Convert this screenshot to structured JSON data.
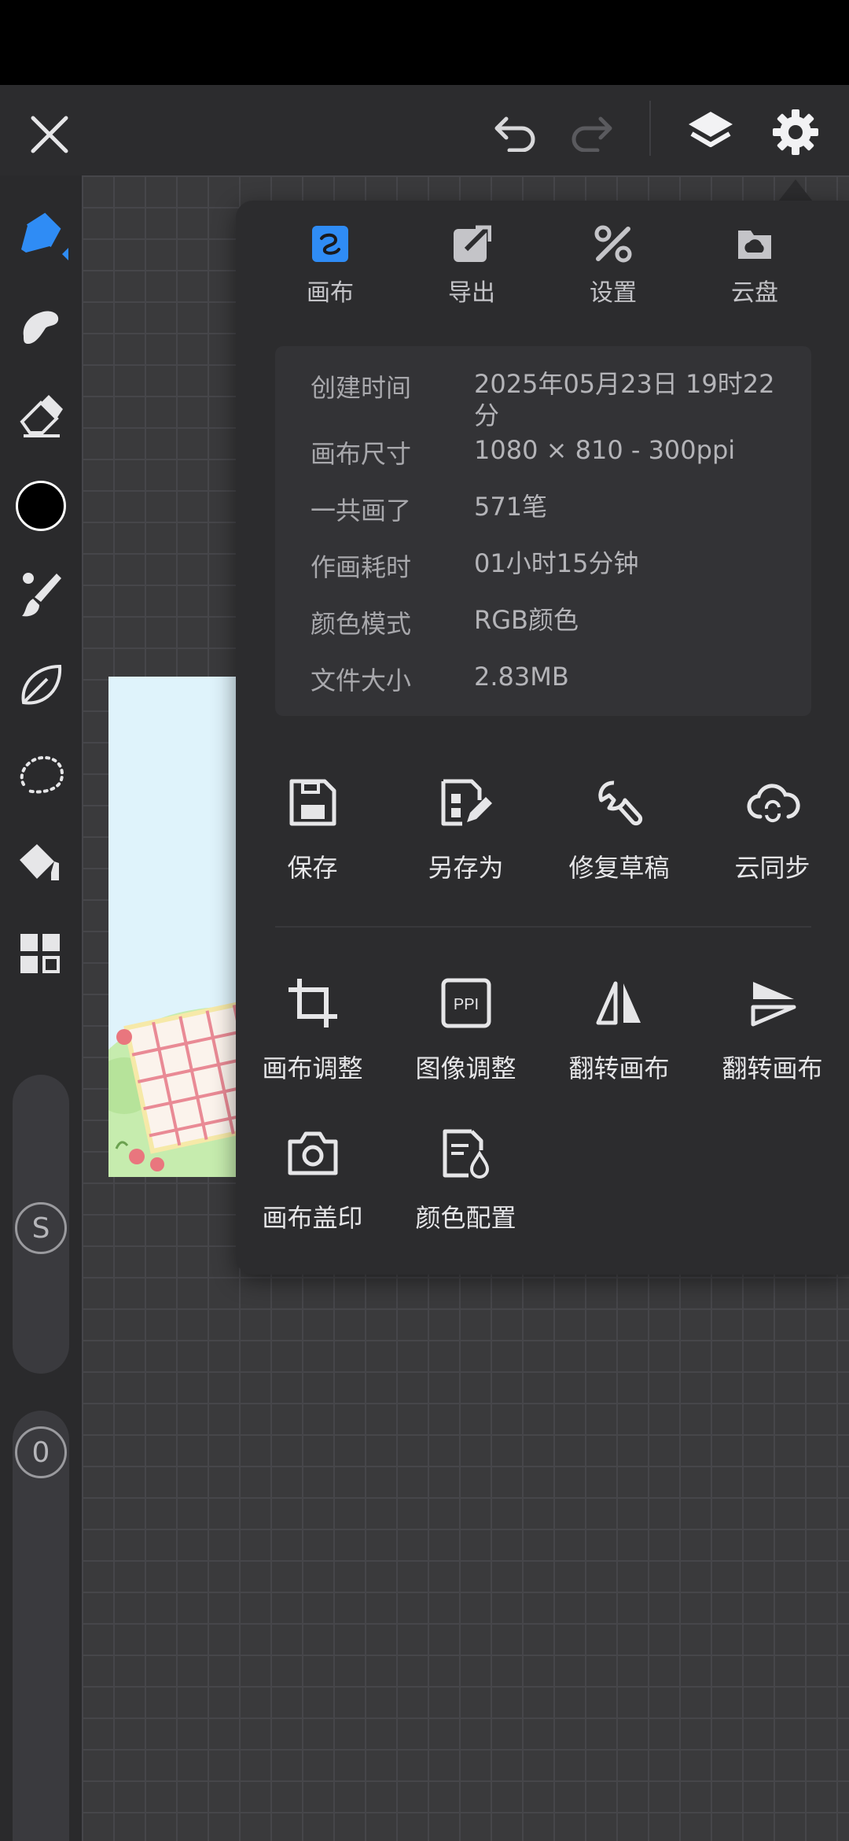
{
  "panel": {
    "tabs": [
      {
        "label": "画布",
        "icon": "canvas-icon",
        "active": true
      },
      {
        "label": "导出",
        "icon": "export-icon"
      },
      {
        "label": "设置",
        "icon": "settings-tools-icon"
      },
      {
        "label": "云盘",
        "icon": "cloud-drive-icon"
      }
    ],
    "info": [
      {
        "key": "创建时间",
        "value": "2025年05月23日 19时22分"
      },
      {
        "key": "画布尺寸",
        "value": "1080 × 810 - 300ppi"
      },
      {
        "key": "一共画了",
        "value": "571笔"
      },
      {
        "key": "作画耗时",
        "value": "01小时15分钟"
      },
      {
        "key": "颜色模式",
        "value": "RGB颜色"
      },
      {
        "key": "文件大小",
        "value": "2.83MB"
      }
    ],
    "actions_row1": [
      {
        "label": "保存",
        "icon": "save-icon"
      },
      {
        "label": "另存为",
        "icon": "save-as-icon"
      },
      {
        "label": "修复草稿",
        "icon": "wrench-icon"
      },
      {
        "label": "云同步",
        "icon": "cloud-sync-icon"
      }
    ],
    "actions_row2": [
      {
        "label": "画布调整",
        "icon": "crop-icon"
      },
      {
        "label": "图像调整",
        "icon": "ppi-icon",
        "icon_text": "PPI"
      },
      {
        "label": "翻转画布",
        "icon": "flip-horizontal-icon"
      },
      {
        "label": "翻转画布",
        "icon": "flip-vertical-icon"
      }
    ],
    "actions_row3": [
      {
        "label": "画布盖印",
        "icon": "camera-icon"
      },
      {
        "label": "颜色配置",
        "icon": "color-profile-icon"
      }
    ]
  },
  "toolbar": {
    "current_color": "#000000",
    "slider_size_label": "S",
    "slider_opacity_label": "0"
  },
  "colors": {
    "accent": "#2f8cf5",
    "panel_bg": "#2c2c2e",
    "background": "#2a2a2c"
  }
}
